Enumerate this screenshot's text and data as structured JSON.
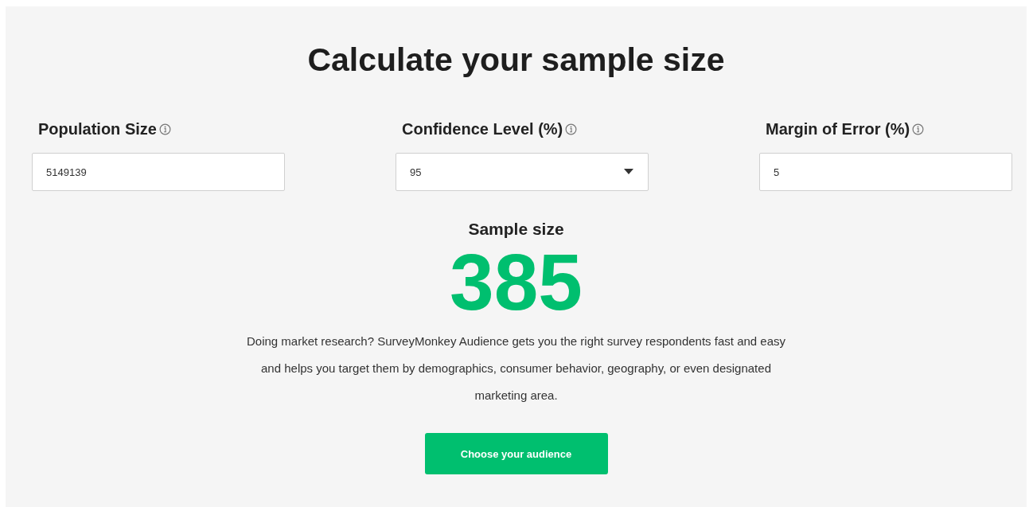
{
  "title": "Calculate your sample size",
  "fields": [
    {
      "label": "Population Size",
      "kind": "input",
      "value": "5149139"
    },
    {
      "label": "Confidence Level (%)",
      "kind": "select",
      "value": "95"
    },
    {
      "label": "Margin of Error (%)",
      "kind": "input",
      "value": "5"
    }
  ],
  "result": {
    "label": "Sample size",
    "value": "385"
  },
  "description": "Doing market research? SurveyMonkey Audience gets you the right survey respondents fast and easy and helps you target them by demographics, consumer behavior, geography, or even designated marketing area.",
  "button": "Choose your audience"
}
